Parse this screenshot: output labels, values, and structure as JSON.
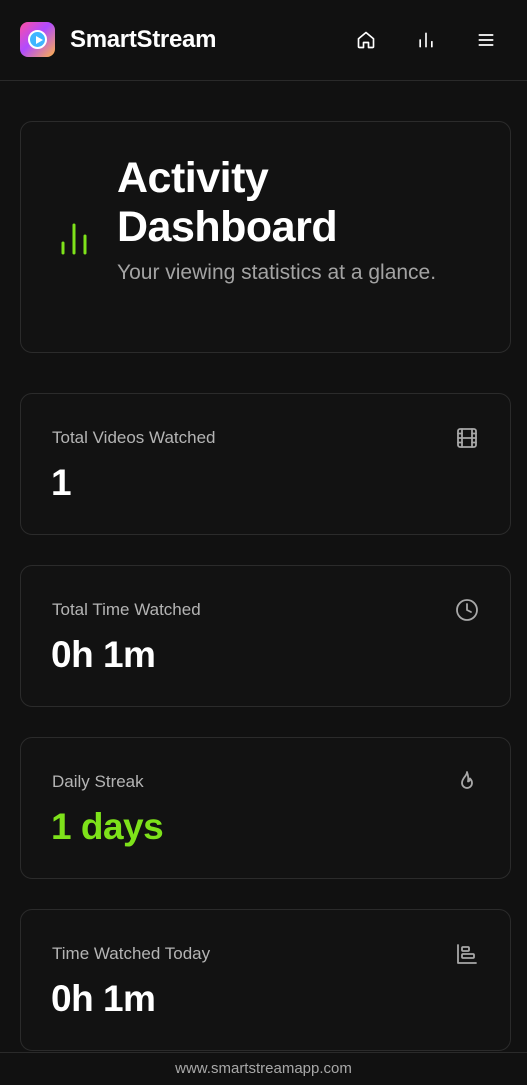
{
  "header": {
    "brand": "SmartStream",
    "nav_icons": [
      "home-icon",
      "bar-chart-icon",
      "menu-icon"
    ]
  },
  "hero": {
    "title": "Activity Dashboard",
    "subtitle": "Your viewing statistics at a glance.",
    "icon": "bar-chart-icon",
    "accent": "#7ee21a"
  },
  "stats": [
    {
      "label": "Total Videos Watched",
      "value": "1",
      "icon": "film-icon"
    },
    {
      "label": "Total Time Watched",
      "value": "0h 1m",
      "icon": "clock-icon"
    },
    {
      "label": "Daily Streak",
      "value": "1 days",
      "icon": "flame-icon",
      "color": "#7ee21a"
    },
    {
      "label": "Time Watched Today",
      "value": "0h 1m",
      "icon": "chart-icon"
    }
  ],
  "footer": {
    "text": "www.smartstreamapp.com"
  },
  "colors": {
    "background": "#111111",
    "border": "#2b2b2b",
    "muted": "#a3a3a3"
  }
}
